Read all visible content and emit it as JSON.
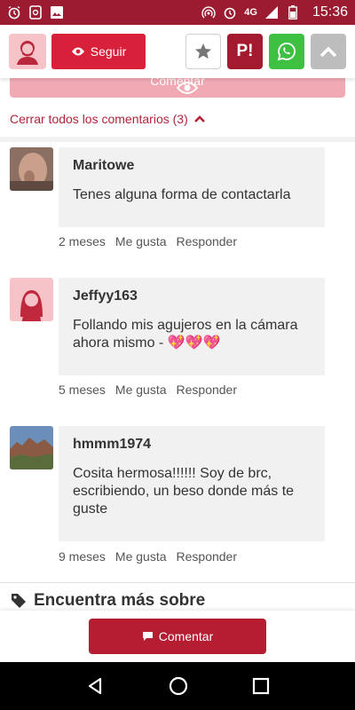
{
  "status_bar": {
    "network": "4G",
    "time": "15:36",
    "background": "#9b1c31"
  },
  "header": {
    "follow_label": "Seguir",
    "buttons": [
      "star-icon",
      "p-logo-icon",
      "whatsapp-icon",
      "chevron-up-icon"
    ],
    "p_logo_text": "P!"
  },
  "top_comment_button_label": "Comentar",
  "close_comments_label": "Cerrar todos los comentarios (3)",
  "comments": [
    {
      "author": "Maritowe",
      "text": "Tenes alguna forma de contactarla",
      "time": "2 meses",
      "like_label": "Me gusta",
      "reply_label": "Responder"
    },
    {
      "author": "Jeffyy163",
      "text": "Follando mis agujeros en la cámara ahora mismo - 💖💖💖",
      "time": "5 meses",
      "like_label": "Me gusta",
      "reply_label": "Responder"
    },
    {
      "author": "hmmm1974",
      "text": "Cosita hermosa!!!!!! Soy de brc, escribiendo, un beso donde más te guste",
      "time": "9 meses",
      "like_label": "Me gusta",
      "reply_label": "Responder"
    }
  ],
  "find_more_label": "Encuentra más sobre",
  "bottom_comment_label": "Comentar",
  "colors": {
    "accent": "#d8203a",
    "dark_accent": "#b61d33",
    "whatsapp": "#3ec142"
  }
}
